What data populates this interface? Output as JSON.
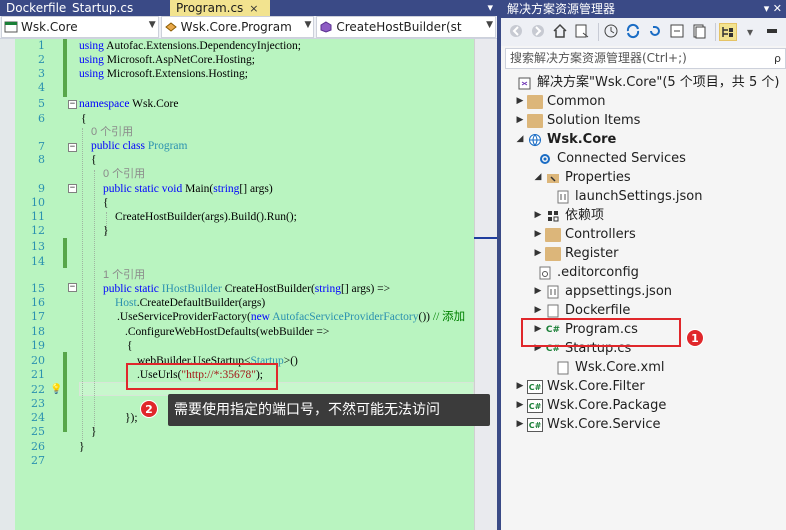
{
  "editor": {
    "tabs": [
      {
        "label": "Dockerfile",
        "active": false
      },
      {
        "label": "Startup.cs",
        "active": false
      },
      {
        "label": "Program.cs",
        "active": true,
        "close": "×"
      }
    ],
    "overflow_icon": "▾",
    "nav": {
      "project": "Wsk.Core",
      "class": "Wsk.Core.Program",
      "member": "CreateHostBuilder(st"
    },
    "line_numbers": [
      "1",
      "2",
      "3",
      "4",
      "5",
      "6",
      "7",
      "8",
      "9",
      "10",
      "11",
      "12",
      "13",
      "14",
      "15",
      "16",
      "17",
      "18",
      "19",
      "20",
      "21",
      "22",
      "23",
      "24",
      "25",
      "26",
      "27"
    ],
    "code": {
      "l1": [
        "using",
        " Autofac.Extensions.DependencyInjection;"
      ],
      "l2": [
        "using",
        " Microsoft.AspNetCore.Hosting;"
      ],
      "l3": [
        "using",
        " Microsoft.Extensions.Hosting;"
      ],
      "l5": [
        "namespace",
        " Wsk.Core"
      ],
      "l6": "{",
      "ref1": "0 个引用",
      "l7": [
        "public",
        " ",
        "class",
        " ",
        "Program"
      ],
      "l8": "{",
      "ref2": "0 个引用",
      "l9": [
        "public",
        " ",
        "static",
        " ",
        "void",
        " Main(",
        "string",
        "[] args)"
      ],
      "l10": "{",
      "l11": "CreateHostBuilder(args).Build().Run();",
      "l12": "}",
      "ref3": "1 个引用",
      "l15": [
        "public",
        " ",
        "static",
        " ",
        "IHostBuilder",
        " CreateHostBuilder(",
        "string",
        "[] args) =>"
      ],
      "l16": [
        "Host",
        ".CreateDefaultBuilder(args)"
      ],
      "l17": [
        ".UseServiceProviderFactory(",
        "new",
        " ",
        "AutofacServiceProviderFactory",
        "()) ",
        "// 添加"
      ],
      "l18": ".ConfigureWebHostDefaults(webBuilder =>",
      "l19": "{",
      "l20": [
        "webBuilder.UseStartup<",
        "Startup",
        ">()"
      ],
      "l21": [
        ".UseUrls(",
        "\"http://*:35678\"",
        ");"
      ],
      "l25": "});",
      "l26": "}",
      "l27": "}"
    },
    "callout2": {
      "number": "2",
      "text": "需要使用指定的端口号，不然可能无法访问"
    }
  },
  "solution_explorer": {
    "title": "解决方案资源管理器",
    "pin_icon": "▾ ✕",
    "search_placeholder": "搜索解决方案资源管理器(Ctrl+;)",
    "search_icon": "ρ",
    "solution_label": "解决方案\"Wsk.Core\"(5 个项目，共 5 个)",
    "items": [
      {
        "label": "Common",
        "icon": "folder-icon"
      },
      {
        "label": "Solution Items",
        "icon": "folder-icon"
      },
      {
        "label": "Wsk.Core",
        "icon": "web-project-icon"
      },
      {
        "label": "Connected Services",
        "icon": "connected-services-icon"
      },
      {
        "label": "Properties",
        "icon": "properties-icon"
      },
      {
        "label": "launchSettings.json",
        "icon": "json-file-icon"
      },
      {
        "label": "依赖项",
        "icon": "dependencies-icon"
      },
      {
        "label": "Controllers",
        "icon": "folder-icon"
      },
      {
        "label": "Register",
        "icon": "folder-icon"
      },
      {
        "label": ".editorconfig",
        "icon": "config-file-icon"
      },
      {
        "label": "appsettings.json",
        "icon": "json-file-icon"
      },
      {
        "label": "Dockerfile",
        "icon": "file-icon"
      },
      {
        "label": "Program.cs",
        "icon": "csharp-file-icon"
      },
      {
        "label": "Startup.cs",
        "icon": "csharp-file-icon"
      },
      {
        "label": "Wsk.Core.xml",
        "icon": "file-icon"
      },
      {
        "label": "Wsk.Core.Filter",
        "icon": "csharp-project-icon"
      },
      {
        "label": "Wsk.Core.Package",
        "icon": "csharp-project-icon"
      },
      {
        "label": "Wsk.Core.Service",
        "icon": "csharp-project-icon"
      }
    ],
    "callout1": {
      "number": "1"
    }
  },
  "colors": {
    "title_bar": "#3a4a86",
    "editor_bg": "#b9f4c0",
    "highlight_red": "#e0272b",
    "active_tab": "#f2e38f"
  }
}
